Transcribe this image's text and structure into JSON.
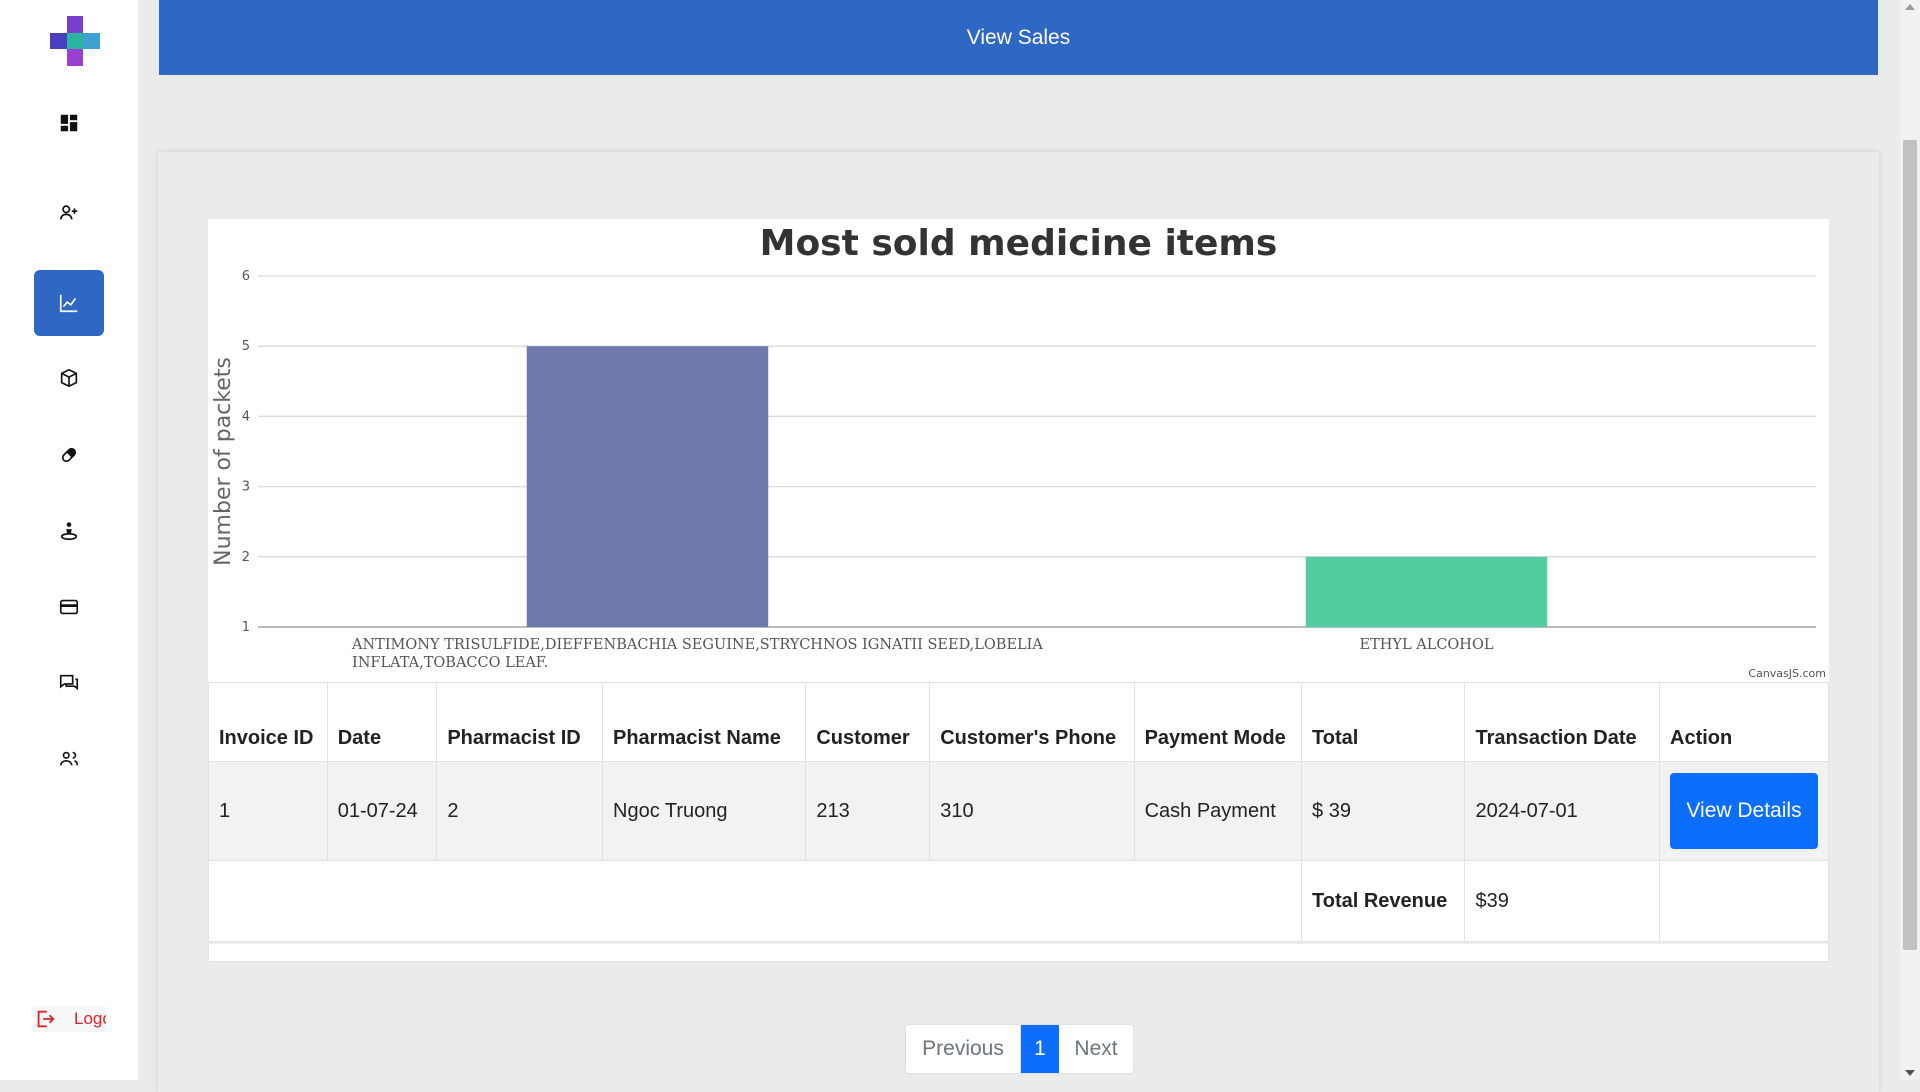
{
  "header": {
    "title": "View Sales"
  },
  "sidebar": {
    "items": [
      {
        "name": "dashboard",
        "icon": "dashboard-icon"
      },
      {
        "name": "add-user",
        "icon": "user-plus-icon"
      },
      {
        "name": "sales",
        "icon": "chart-line-icon",
        "active": true
      },
      {
        "name": "inventory",
        "icon": "box-icon"
      },
      {
        "name": "medicine",
        "icon": "pill-icon"
      },
      {
        "name": "supplier",
        "icon": "person-icon"
      },
      {
        "name": "payment",
        "icon": "credit-card-icon"
      },
      {
        "name": "messages",
        "icon": "chat-icon"
      },
      {
        "name": "users",
        "icon": "users-icon"
      }
    ],
    "logout_label": "Logout",
    "accent_color": "#2f67c4"
  },
  "chart_data": {
    "type": "bar",
    "title": "Most sold medicine items",
    "ylabel": "Number of packets",
    "xlabel": "",
    "ylim": [
      1,
      6
    ],
    "yticks": [
      1,
      2,
      3,
      4,
      5,
      6
    ],
    "grid": true,
    "categories": [
      "ANTIMONY TRISULFIDE,DIEFFENBACHIA SEGUINE,STRYCHNOS IGNATII SEED,LOBELIA INFLATA,TOBACCO LEAF.",
      "ETHYL ALCOHOL"
    ],
    "category_lines": [
      [
        "ANTIMONY TRISULFIDE,DIEFFENBACHIA SEGUINE,STRYCHNOS IGNATII SEED,LOBELIA",
        "INFLATA,TOBACCO LEAF."
      ],
      [
        "ETHYL ALCOHOL"
      ]
    ],
    "values": [
      5,
      2
    ],
    "colors": [
      "#6d78ad",
      "#51cda0"
    ],
    "credit": "CanvasJS.com"
  },
  "table": {
    "headers": [
      "Invoice ID",
      "Date",
      "Pharmacist ID",
      "Pharmacist Name",
      "Customer",
      "Customer's Phone",
      "Payment Mode",
      "Total",
      "Transaction Date",
      "Action"
    ],
    "rows": [
      [
        "1",
        "01-07-24",
        "2",
        "Ngoc Truong",
        "213",
        "310",
        "Cash Payment",
        "$ 39",
        "2024-07-01"
      ]
    ],
    "action_label": "View Details",
    "total_label": "Total Revenue",
    "total_value": "$39"
  },
  "pagination": {
    "previous": "Previous",
    "current": "1",
    "next": "Next"
  }
}
